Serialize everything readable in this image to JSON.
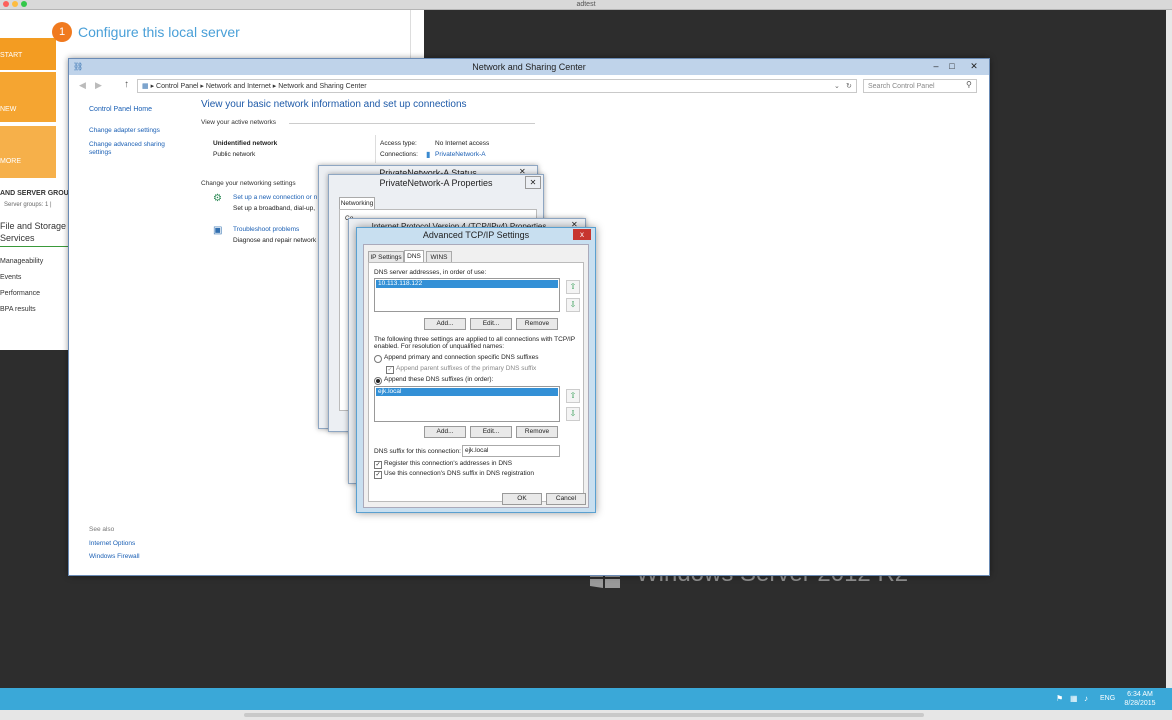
{
  "host": {
    "title": "adtest"
  },
  "server_manager": {
    "step_number": "1",
    "configure_title": "Configure this local server",
    "tiles": [
      "START",
      "NEW",
      "MORE"
    ],
    "groups_title": "AND SERVER GROU",
    "groups_sub": "Server groups: 1  |",
    "groups": [
      "File and Storage Services",
      "Manageability",
      "Events",
      "Performance",
      "BPA results"
    ]
  },
  "wallpaper": {
    "text": "Windows Server 2012 R2"
  },
  "nsc": {
    "title": "Network and Sharing Center",
    "breadcrumb": [
      "Control Panel",
      "Network and Internet",
      "Network and Sharing Center"
    ],
    "search_placeholder": "Search Control Panel",
    "sidebar": {
      "home": "Control Panel Home",
      "change_adapter": "Change adapter settings",
      "change_sharing": "Change advanced sharing settings",
      "see_also": "See also",
      "internet_options": "Internet Options",
      "windows_firewall": "Windows Firewall"
    },
    "heading": "View your basic network information and set up connections",
    "active_networks": "View your active networks",
    "network_name": "Unidentified network",
    "network_type": "Public network",
    "access_type_label": "Access type:",
    "access_type_value": "No Internet access",
    "connections_label": "Connections:",
    "connections_value": "PrivateNetwork-A",
    "change_settings": "Change your networking settings",
    "setup_link": "Set up a new connection or n",
    "setup_desc": "Set up a broadband, dial-up,",
    "troubleshoot_link": "Troubleshoot problems",
    "troubleshoot_desc": "Diagnose and repair network"
  },
  "status_dialog": {
    "title": "PrivateNetwork-A Status"
  },
  "properties_dialog": {
    "title": "PrivateNetwork-A Properties",
    "tab": "Networking",
    "partial": "Co"
  },
  "ipv4_dialog": {
    "title": "Internet Protocol Version 4 (TCP/IPv4) Properties"
  },
  "advanced": {
    "title": "Advanced TCP/IP Settings",
    "close": "x",
    "tabs": [
      "IP Settings",
      "DNS",
      "WINS"
    ],
    "dns_label": "DNS server addresses, in order of use:",
    "dns_servers": [
      "10.113.118.122"
    ],
    "add": "Add...",
    "edit": "Edit...",
    "remove": "Remove",
    "info": "The following three settings are applied to all connections with TCP/IP enabled. For resolution of unqualified names:",
    "radio_primary": "Append primary and connection specific DNS suffixes",
    "cb_parent": "Append parent suffixes of the primary DNS suffix",
    "radio_these": "Append these DNS suffixes (in order):",
    "suffixes": [
      "ejk.local"
    ],
    "suffix_label": "DNS suffix for this connection:",
    "suffix_value": "ejk.local",
    "cb_register": "Register this connection's addresses in DNS",
    "cb_use_suffix": "Use this connection's DNS suffix in DNS registration",
    "ok": "OK",
    "cancel": "Cancel"
  },
  "taskbar": {
    "lang": "ENG",
    "time": "6:34 AM",
    "date": "8/28/2015"
  }
}
